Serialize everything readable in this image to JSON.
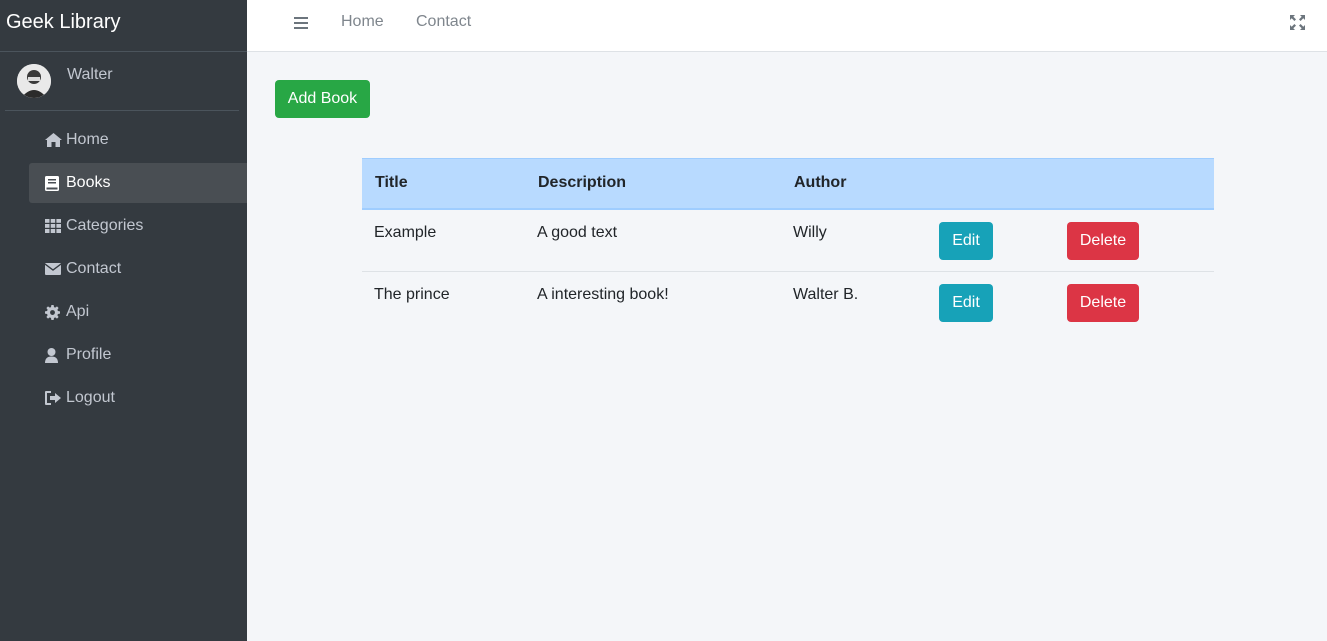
{
  "brand": {
    "title": "Geek Library"
  },
  "user": {
    "name": "Walter"
  },
  "sidebar": {
    "items": [
      {
        "label": "Home",
        "icon": "home-icon"
      },
      {
        "label": "Books",
        "icon": "book-icon",
        "active": true
      },
      {
        "label": "Categories",
        "icon": "grid-icon"
      },
      {
        "label": "Contact",
        "icon": "envelope-icon"
      },
      {
        "label": "Api",
        "icon": "gear-icon"
      },
      {
        "label": "Profile",
        "icon": "user-icon"
      },
      {
        "label": "Logout",
        "icon": "sign-out-icon"
      }
    ]
  },
  "topnav": {
    "links": [
      "Home",
      "Contact"
    ],
    "icons": [
      "menu-icon",
      "fullscreen-icon"
    ]
  },
  "actions": {
    "add_book": "Add Book"
  },
  "table": {
    "headers": [
      "Title",
      "Description",
      "Author"
    ],
    "rows": [
      {
        "title": "Example",
        "description": "A good text",
        "author": "Willy",
        "edit": "Edit",
        "delete": "Delete"
      },
      {
        "title": "The prince",
        "description": "A interesting book!",
        "author": "Walter B.",
        "edit": "Edit",
        "delete": "Delete"
      }
    ]
  },
  "colors": {
    "sidebar_bg": "#343a40",
    "add_button": "#28a745",
    "edit_button": "#17a2b8",
    "delete_button": "#dc3545",
    "table_header": "#b8daff"
  }
}
